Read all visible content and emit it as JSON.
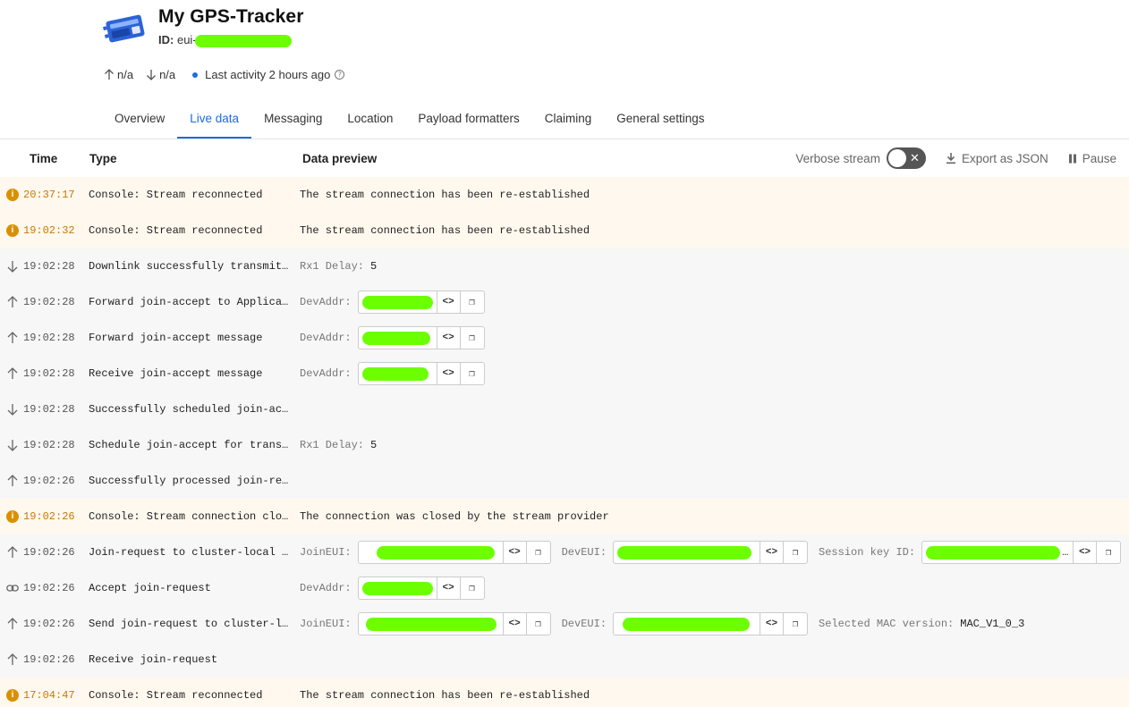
{
  "device": {
    "title": "My GPS-Tracker",
    "id_label": "ID:",
    "id_value": "eui-"
  },
  "stats": {
    "up": "n/a",
    "down": "n/a",
    "activity": "Last activity 2 hours ago",
    "help": "?"
  },
  "tabs": [
    "Overview",
    "Live data",
    "Messaging",
    "Location",
    "Payload formatters",
    "Claiming",
    "General settings"
  ],
  "active_tab": "Live data",
  "table": {
    "col_time": "Time",
    "col_type": "Type",
    "col_preview": "Data preview",
    "verbose_label": "Verbose stream",
    "verbose_state": "off",
    "export_label": "Export as JSON",
    "pause_label": "Pause"
  },
  "rows": [
    {
      "icon": "warning",
      "time": "20:37:17",
      "type": "Console: Stream reconnected",
      "text": "The stream connection has been re-established"
    },
    {
      "icon": "warning",
      "time": "19:02:32",
      "type": "Console: Stream reconnected",
      "text": "The stream connection has been re-established"
    },
    {
      "icon": "down",
      "time": "19:02:28",
      "type": "Downlink successfully transmit…",
      "label": "Rx1 Delay:",
      "value": "5"
    },
    {
      "icon": "up",
      "time": "19:02:28",
      "type": "Forward join-accept to Applica…",
      "label": "DevAddr:"
    },
    {
      "icon": "up",
      "time": "19:02:28",
      "type": "Forward join-accept message",
      "label": "DevAddr:"
    },
    {
      "icon": "up",
      "time": "19:02:28",
      "type": "Receive join-accept message",
      "label": "DevAddr:"
    },
    {
      "icon": "down",
      "time": "19:02:28",
      "type": "Successfully scheduled join-ac…"
    },
    {
      "icon": "down",
      "time": "19:02:28",
      "type": "Schedule join-accept for trans…",
      "label": "Rx1 Delay:",
      "value": "5"
    },
    {
      "icon": "up",
      "time": "19:02:26",
      "type": "Successfully processed join-re…"
    },
    {
      "icon": "warning",
      "time": "19:02:26",
      "type": "Console: Stream connection clo…",
      "text": "The connection was closed by the stream provider"
    },
    {
      "icon": "up",
      "time": "19:02:26",
      "type": "Join-request to cluster-local …",
      "label": "JoinEUI:",
      "label2": "DevEUI:",
      "label3": "Session key ID:"
    },
    {
      "icon": "link",
      "time": "19:02:26",
      "type": "Accept join-request",
      "label": "DevAddr:"
    },
    {
      "icon": "up",
      "time": "19:02:26",
      "type": "Send join-request to cluster-l…",
      "label": "JoinEUI:",
      "label2": "DevEUI:",
      "label3": "Selected MAC version:",
      "value3": "MAC_V1_0_3"
    },
    {
      "icon": "up",
      "time": "19:02:26",
      "type": "Receive join-request"
    },
    {
      "icon": "warning",
      "time": "17:04:47",
      "type": "Console: Stream reconnected",
      "text": "The stream connection has been re-established"
    }
  ],
  "colors": {
    "accent": "#1d6be0",
    "warning": "#d99000",
    "redaction": "#6cff00"
  }
}
